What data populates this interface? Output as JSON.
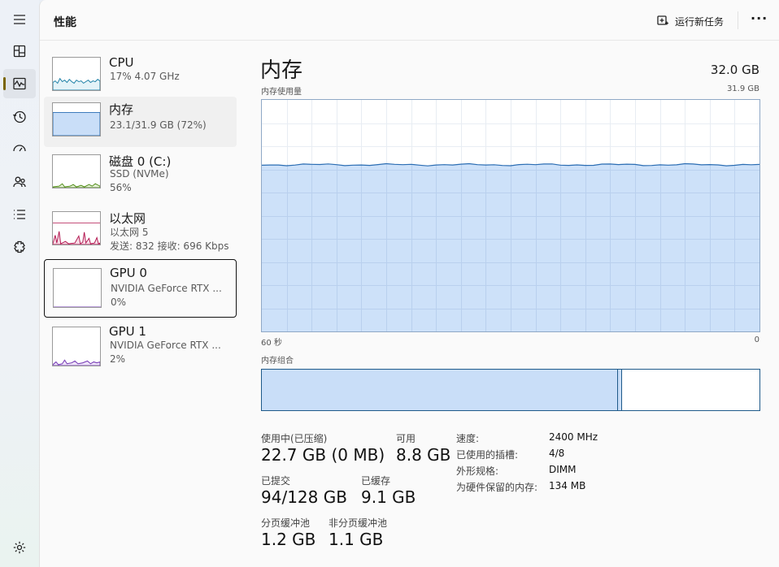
{
  "app": {
    "page_title": "性能",
    "new_task_label": "运行新任务",
    "more_label": "···"
  },
  "rail": {
    "items": [
      {
        "icon": "menu-icon"
      },
      {
        "icon": "processes-icon"
      },
      {
        "icon": "performance-icon"
      },
      {
        "icon": "app-history-icon"
      },
      {
        "icon": "startup-apps-icon"
      },
      {
        "icon": "users-icon"
      },
      {
        "icon": "details-icon"
      },
      {
        "icon": "services-icon"
      },
      {
        "icon": "settings-icon"
      }
    ]
  },
  "devices": [
    {
      "name": "CPU",
      "line1": "17% 4.07 GHz",
      "line2": "",
      "color": "#1b7fa6",
      "fill": "#e4f3f8",
      "level": 0.17
    },
    {
      "name": "内存",
      "line1": "23.1/31.9 GB (72%)",
      "line2": "",
      "color": "#2b6db3",
      "fill": "#c9def8",
      "level": 0.72
    },
    {
      "name": "磁盘 0 (C:)",
      "line1": "SSD (NVMe)",
      "line2": "56%",
      "color": "#4d8a12",
      "fill": "#e5f0d8",
      "level": 0.05
    },
    {
      "name": "以太网",
      "line1": "以太网 5",
      "line2": "发送: 832 接收: 696 Kbps",
      "color": "#b2154f",
      "fill": "#f6dbe5",
      "level": 0.3
    },
    {
      "name": "GPU 0",
      "line1": "NVIDIA GeForce RTX ...",
      "line2": "0%",
      "color": "#7a3fb8",
      "fill": "#eee4f8",
      "level": 0.0
    },
    {
      "name": "GPU 1",
      "line1": "NVIDIA GeForce RTX ...",
      "line2": "2%",
      "color": "#7a3fb8",
      "fill": "#eee4f8",
      "level": 0.02
    }
  ],
  "detail": {
    "title": "内存",
    "total": "32.0 GB",
    "usage_label": "内存使用量",
    "usage_max": "31.9 GB",
    "x_left": "60 秒",
    "x_right": "0",
    "composition_label": "内存组合",
    "usage_level": 0.72,
    "stats": {
      "in_use_label": "使用中(已压缩)",
      "in_use_value": "22.7 GB (0 MB)",
      "available_label": "可用",
      "available_value": "8.8 GB",
      "committed_label": "已提交",
      "committed_value": "94/128 GB",
      "cached_label": "已缓存",
      "cached_value": "9.1 GB",
      "paged_label": "分页缓冲池",
      "paged_value": "1.2 GB",
      "nonpaged_label": "非分页缓冲池",
      "nonpaged_value": "1.1 GB"
    },
    "props": [
      {
        "key": "速度:",
        "value": "2400 MHz"
      },
      {
        "key": "已使用的插槽:",
        "value": "4/8"
      },
      {
        "key": "外形规格:",
        "value": "DIMM"
      },
      {
        "key": "为硬件保留的内存:",
        "value": "134 MB"
      }
    ]
  }
}
